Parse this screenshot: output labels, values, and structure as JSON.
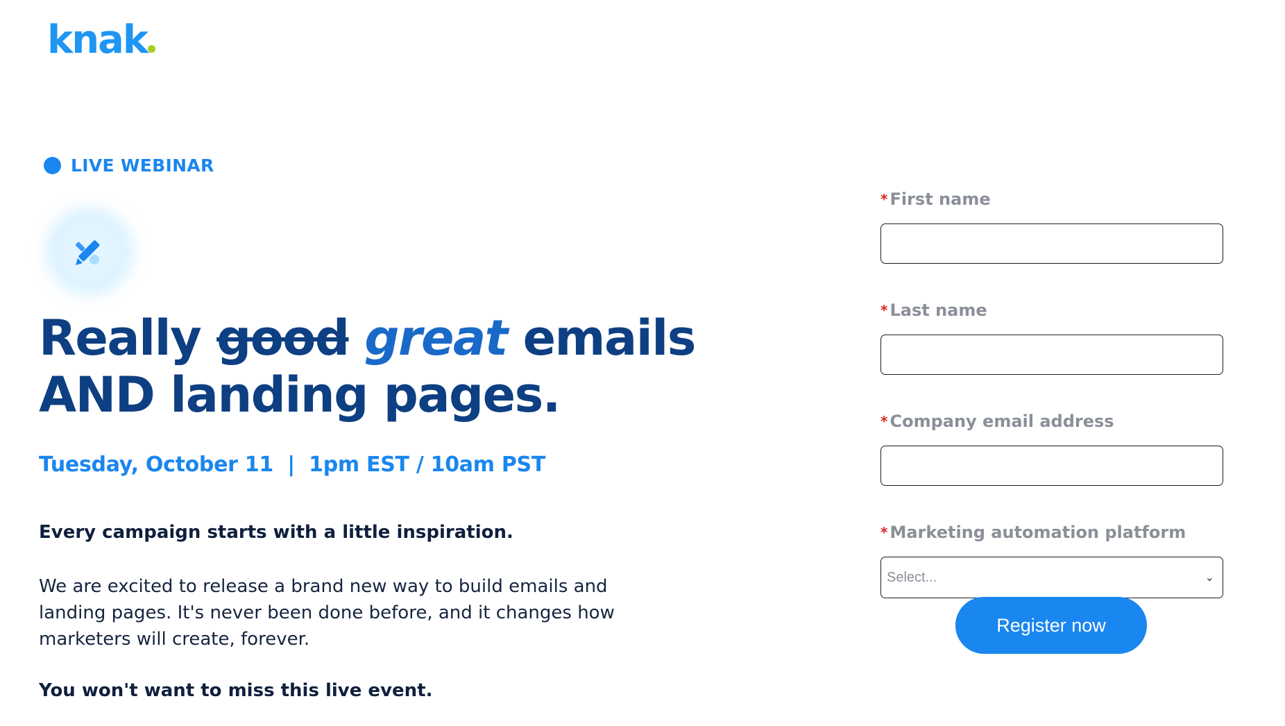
{
  "brand": {
    "logo_text": "knak",
    "accent_color": "#1f96f3",
    "dot_color": "#a3cf1f"
  },
  "hero": {
    "tag_label": "LIVE WEBINAR",
    "icon": "pencil-icon",
    "headline_word1": "Really",
    "headline_strike": "good",
    "headline_italic": "great",
    "headline_word4": "emails",
    "headline_line2": "AND landing pages.",
    "date_text": "Tuesday, October 11  |  1pm EST / 10am PST",
    "intro": "Every campaign starts with a little inspiration.",
    "body": "We are excited to release a brand new way to build emails and landing pages. It's never been done before, and it changes how marketers will create, forever.",
    "closing": "You won't want to miss this live event."
  },
  "form": {
    "required_marker": "*",
    "first_name_label": "First name",
    "first_name_value": "",
    "last_name_label": "Last name",
    "last_name_value": "",
    "email_label": "Company email address",
    "email_value": "",
    "platform_label": "Marketing automation platform",
    "platform_selected": "Select...",
    "submit_label": "Register now"
  }
}
